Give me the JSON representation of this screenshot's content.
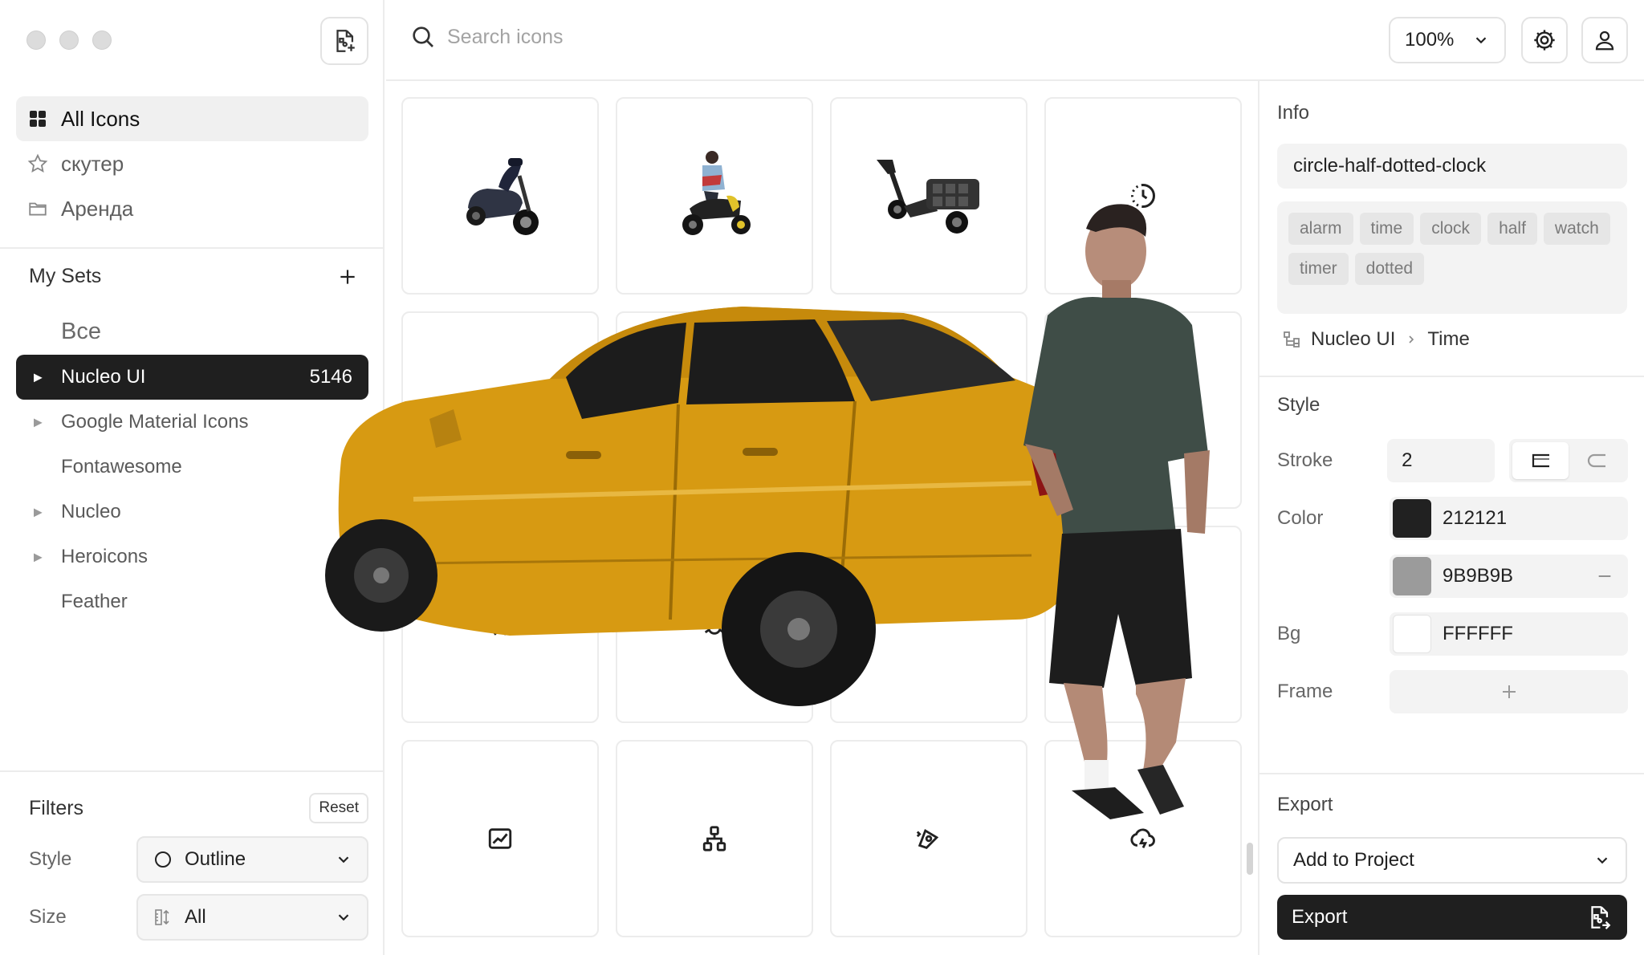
{
  "sidebar": {
    "nav": [
      {
        "label": "All Icons",
        "icon": "grid-icon",
        "active": true
      },
      {
        "label": "скутер",
        "icon": "star-icon",
        "active": false
      },
      {
        "label": "Аренда",
        "icon": "folder-icon",
        "active": false
      }
    ],
    "sets_title": "My Sets",
    "sets": [
      {
        "label": "Все",
        "count": "",
        "has_arrow": false,
        "active": false,
        "big": true
      },
      {
        "label": "Nucleo UI",
        "count": "5146",
        "has_arrow": true,
        "active": true
      },
      {
        "label": "Google Material Icons",
        "count": "",
        "has_arrow": true,
        "active": false
      },
      {
        "label": "Fontawesome",
        "count": "",
        "has_arrow": false,
        "active": false
      },
      {
        "label": "Nucleo",
        "count": "",
        "has_arrow": true,
        "active": false
      },
      {
        "label": "Heroicons",
        "count": "",
        "has_arrow": true,
        "active": false
      },
      {
        "label": "Feather",
        "count": "",
        "has_arrow": false,
        "active": false
      }
    ],
    "filters": {
      "title": "Filters",
      "reset_label": "Reset",
      "style_label": "Style",
      "style_value": "Outline",
      "size_label": "Size",
      "size_value": "All"
    }
  },
  "topbar": {
    "search_placeholder": "Search icons",
    "zoom": "100%"
  },
  "grid": {
    "tiles": [
      {
        "icon": "scooter-image"
      },
      {
        "icon": "rider-image"
      },
      {
        "icon": "cargo-scooter-image"
      },
      {
        "icon": "circle-half-dotted-clock-icon"
      },
      {
        "icon": "blank"
      },
      {
        "icon": "blank"
      },
      {
        "icon": "blank"
      },
      {
        "icon": "blank"
      },
      {
        "icon": "alarm-clock-icon"
      },
      {
        "icon": "bug-icon"
      },
      {
        "icon": "blank"
      },
      {
        "icon": "puzzle-icon"
      },
      {
        "icon": "chart-frame-icon"
      },
      {
        "icon": "hierarchy-icon"
      },
      {
        "icon": "pen-tool-icon"
      },
      {
        "icon": "cloud-lightning-icon"
      }
    ]
  },
  "panel": {
    "info_title": "Info",
    "icon_name": "circle-half-dotted-clock",
    "tags": [
      "alarm",
      "time",
      "clock",
      "half",
      "watch",
      "timer",
      "dotted"
    ],
    "breadcrumb_set": "Nucleo UI",
    "breadcrumb_category": "Time",
    "style_title": "Style",
    "stroke_label": "Stroke",
    "stroke_value": "2",
    "color_label": "Color",
    "color_primary": "212121",
    "color_secondary": "9B9B9B",
    "bg_label": "Bg",
    "bg_value": "FFFFFF",
    "frame_label": "Frame",
    "export_title": "Export",
    "export_target": "Add to Project",
    "export_button": "Export"
  },
  "colors": {
    "accent_dark": "#1f1f1f",
    "primary_swatch": "#212121",
    "secondary_swatch": "#9b9b9b",
    "bg_swatch": "#ffffff",
    "car": "#d79a12"
  }
}
